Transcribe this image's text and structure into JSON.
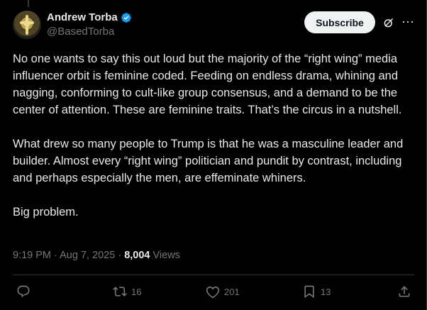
{
  "author": {
    "display_name": "Andrew Torba",
    "handle": "@BasedTorba"
  },
  "header_actions": {
    "subscribe_label": "Subscribe"
  },
  "post": {
    "paragraphs": [
      "No one wants to say this out loud but the majority of the “right wing” media influencer orbit is feminine coded. Feeding on endless drama, whining and nagging, conforming to cult-like group consensus, and a demand to be the center of attention. These are feminine traits. That’s the circus in a nutshell.",
      "What drew so many people to Trump is that he was a masculine leader and builder. Almost every “right wing” politician and pundit by contrast, including and perhaps especially the men, are effeminate whiners.",
      "Big problem."
    ],
    "timestamp": "9:19 PM · Aug 7, 2025 · ",
    "views_count": "8,004",
    "views_label": " Views"
  },
  "engagement": {
    "replies": "",
    "reposts": "16",
    "likes": "201",
    "bookmarks": "13"
  },
  "icons": {
    "verified": "verified-badge-icon",
    "grok": "grok-icon",
    "more": "more-icon",
    "reply": "reply-icon",
    "repost": "repost-icon",
    "like": "heart-icon",
    "bookmark": "bookmark-icon",
    "share": "share-icon"
  },
  "colors": {
    "background": "#000000",
    "text": "#e7e9ea",
    "muted": "#71767b",
    "verified_blue": "#1d9bf0",
    "subscribe_bg": "#eff3f4"
  }
}
